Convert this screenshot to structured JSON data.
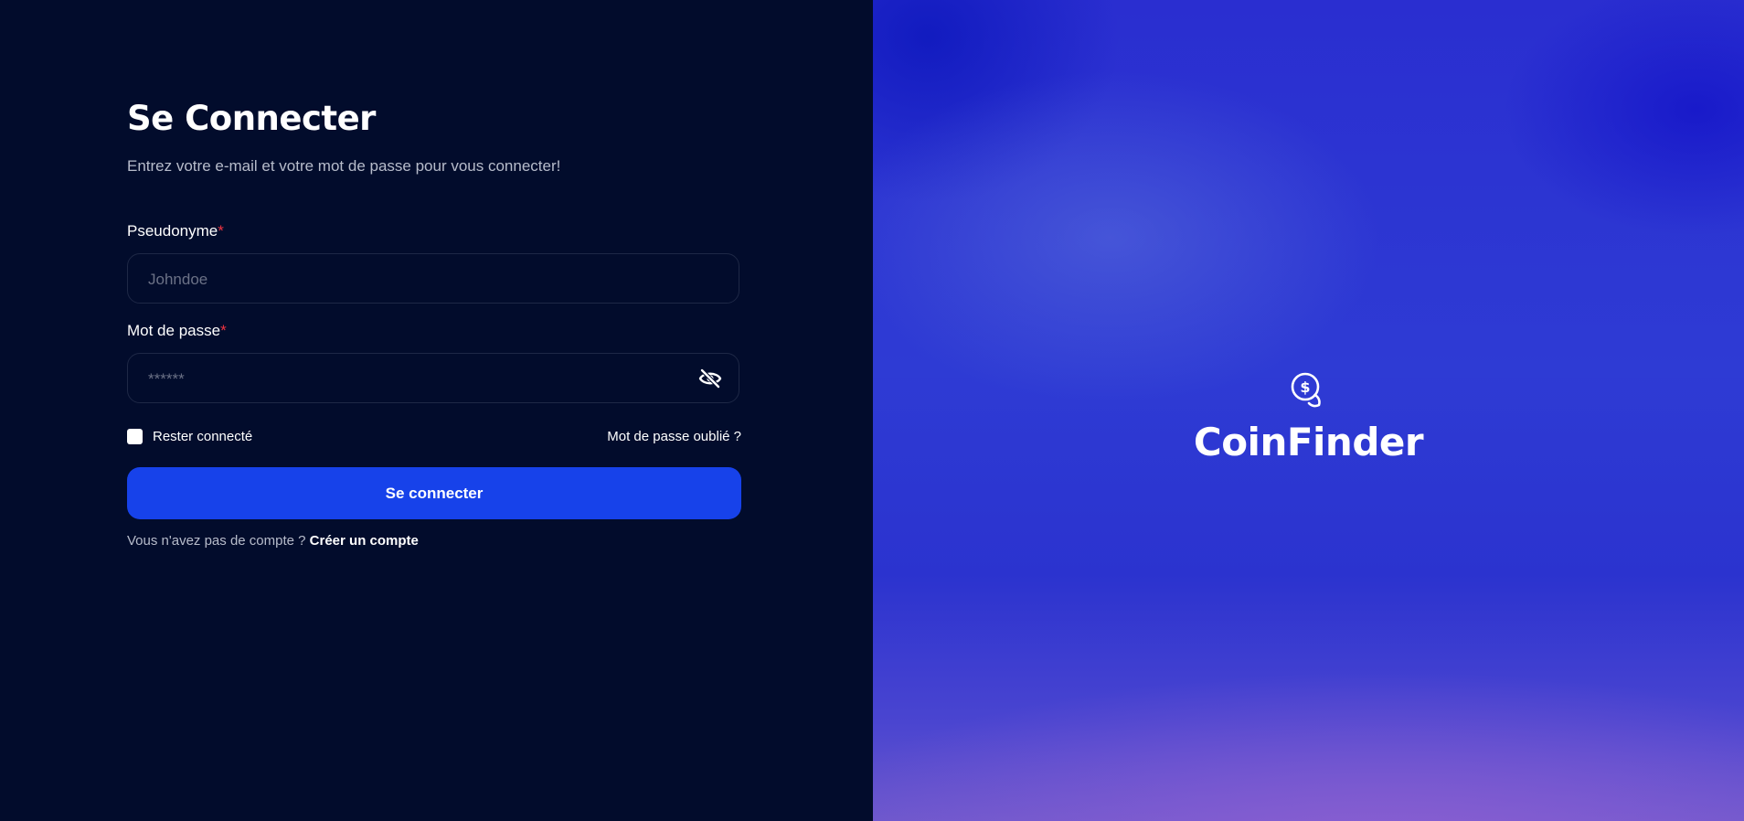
{
  "login": {
    "title": "Se Connecter",
    "subtitle": "Entrez votre e-mail et votre mot de passe pour vous connecter!",
    "username_label": "Pseudonyme",
    "username_placeholder": "Johndoe",
    "password_label": "Mot de passe",
    "password_placeholder": "******",
    "required_mark": "*",
    "remember_label": "Rester connecté",
    "remember_checked": false,
    "forgot_link": "Mot de passe oublié ?",
    "submit_label": "Se connecter",
    "no_account_text": "Vous n'avez pas de compte ?",
    "create_account_link": "Créer un compte"
  },
  "brand": {
    "name": "CoinFinder",
    "icon": "coin-dollar-icon"
  },
  "colors": {
    "background": "#020c2c",
    "primary_button": "#1742ea",
    "required": "#ef3340",
    "panel_blue": "#2e3bd4",
    "panel_purple": "#6a57cc"
  }
}
